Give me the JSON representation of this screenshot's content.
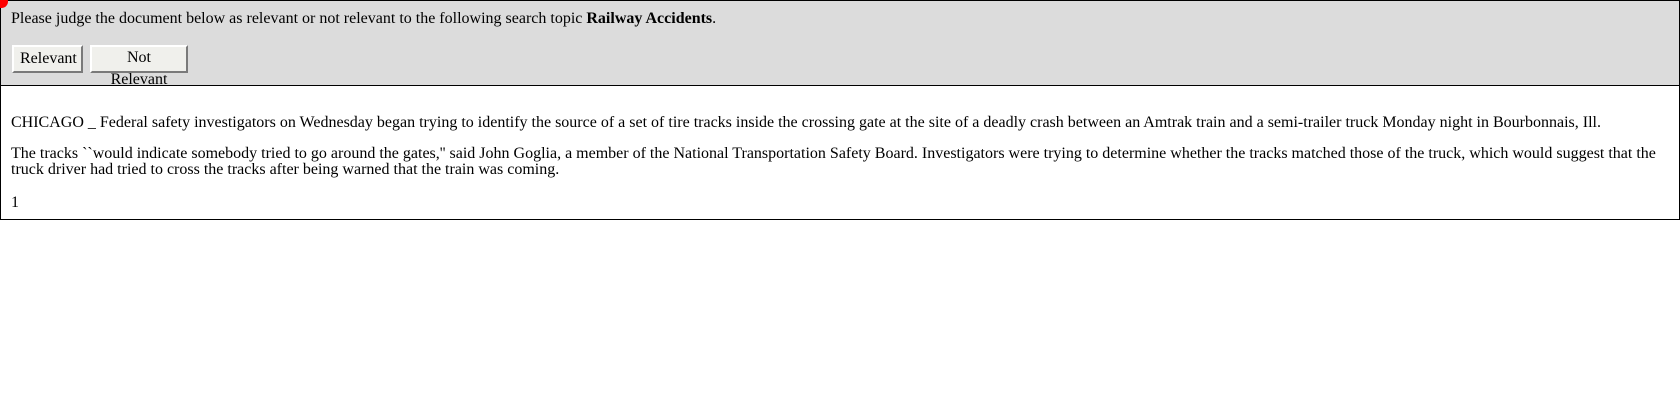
{
  "header": {
    "prompt_prefix": "Please judge the document below as relevant or not relevant to the following search topic ",
    "topic": "Railway Accidents",
    "prompt_suffix": ".",
    "buttons": {
      "relevant": "Relevant",
      "not_relevant": "Not Relevant"
    }
  },
  "document": {
    "paragraphs": [
      "CHICAGO _ Federal safety investigators on Wednesday began trying to identify the source of a set of tire tracks inside the crossing gate at the site of a deadly crash between an Amtrak train and a semi-trailer truck Monday night in Bourbonnais, Ill.",
      "The tracks ``would indicate somebody tried to go around the gates,'' said John Goglia, a member of the National Transportation Safety Board. Investigators were trying to determine whether the tracks matched those of the truck, which would suggest that the truck driver had tried to cross the tracks after being warned that the train was coming."
    ],
    "page_number": "1"
  },
  "colors": {
    "header_bg": "#dcdcdc",
    "border": "#000000",
    "cursor_marker": "#ff0000"
  }
}
